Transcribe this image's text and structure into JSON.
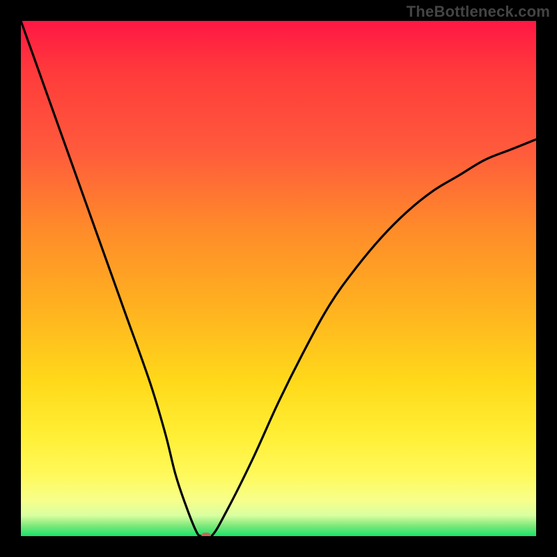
{
  "watermark": "TheBottleneck.com",
  "chart_data": {
    "type": "line",
    "title": "",
    "xlabel": "",
    "ylabel": "",
    "xlim": [
      0,
      100
    ],
    "ylim": [
      0,
      100
    ],
    "grid": false,
    "series": [
      {
        "name": "bottleneck-curve",
        "x": [
          0,
          5,
          10,
          15,
          20,
          25,
          28,
          30,
          32,
          34,
          35,
          37,
          40,
          45,
          50,
          55,
          60,
          65,
          70,
          75,
          80,
          85,
          90,
          95,
          100
        ],
        "values": [
          100,
          86,
          72,
          58,
          44,
          30,
          20,
          12,
          6,
          1,
          0,
          0,
          5,
          15,
          26,
          36,
          45,
          52,
          58,
          63,
          67,
          70,
          73,
          75,
          77
        ]
      }
    ],
    "annotations": [
      {
        "name": "optimal-marker",
        "x": 36,
        "y": 0
      }
    ],
    "background_gradient": {
      "top": "#ff1744",
      "mid": "#ffd91a",
      "bottom": "#17e36b"
    }
  }
}
